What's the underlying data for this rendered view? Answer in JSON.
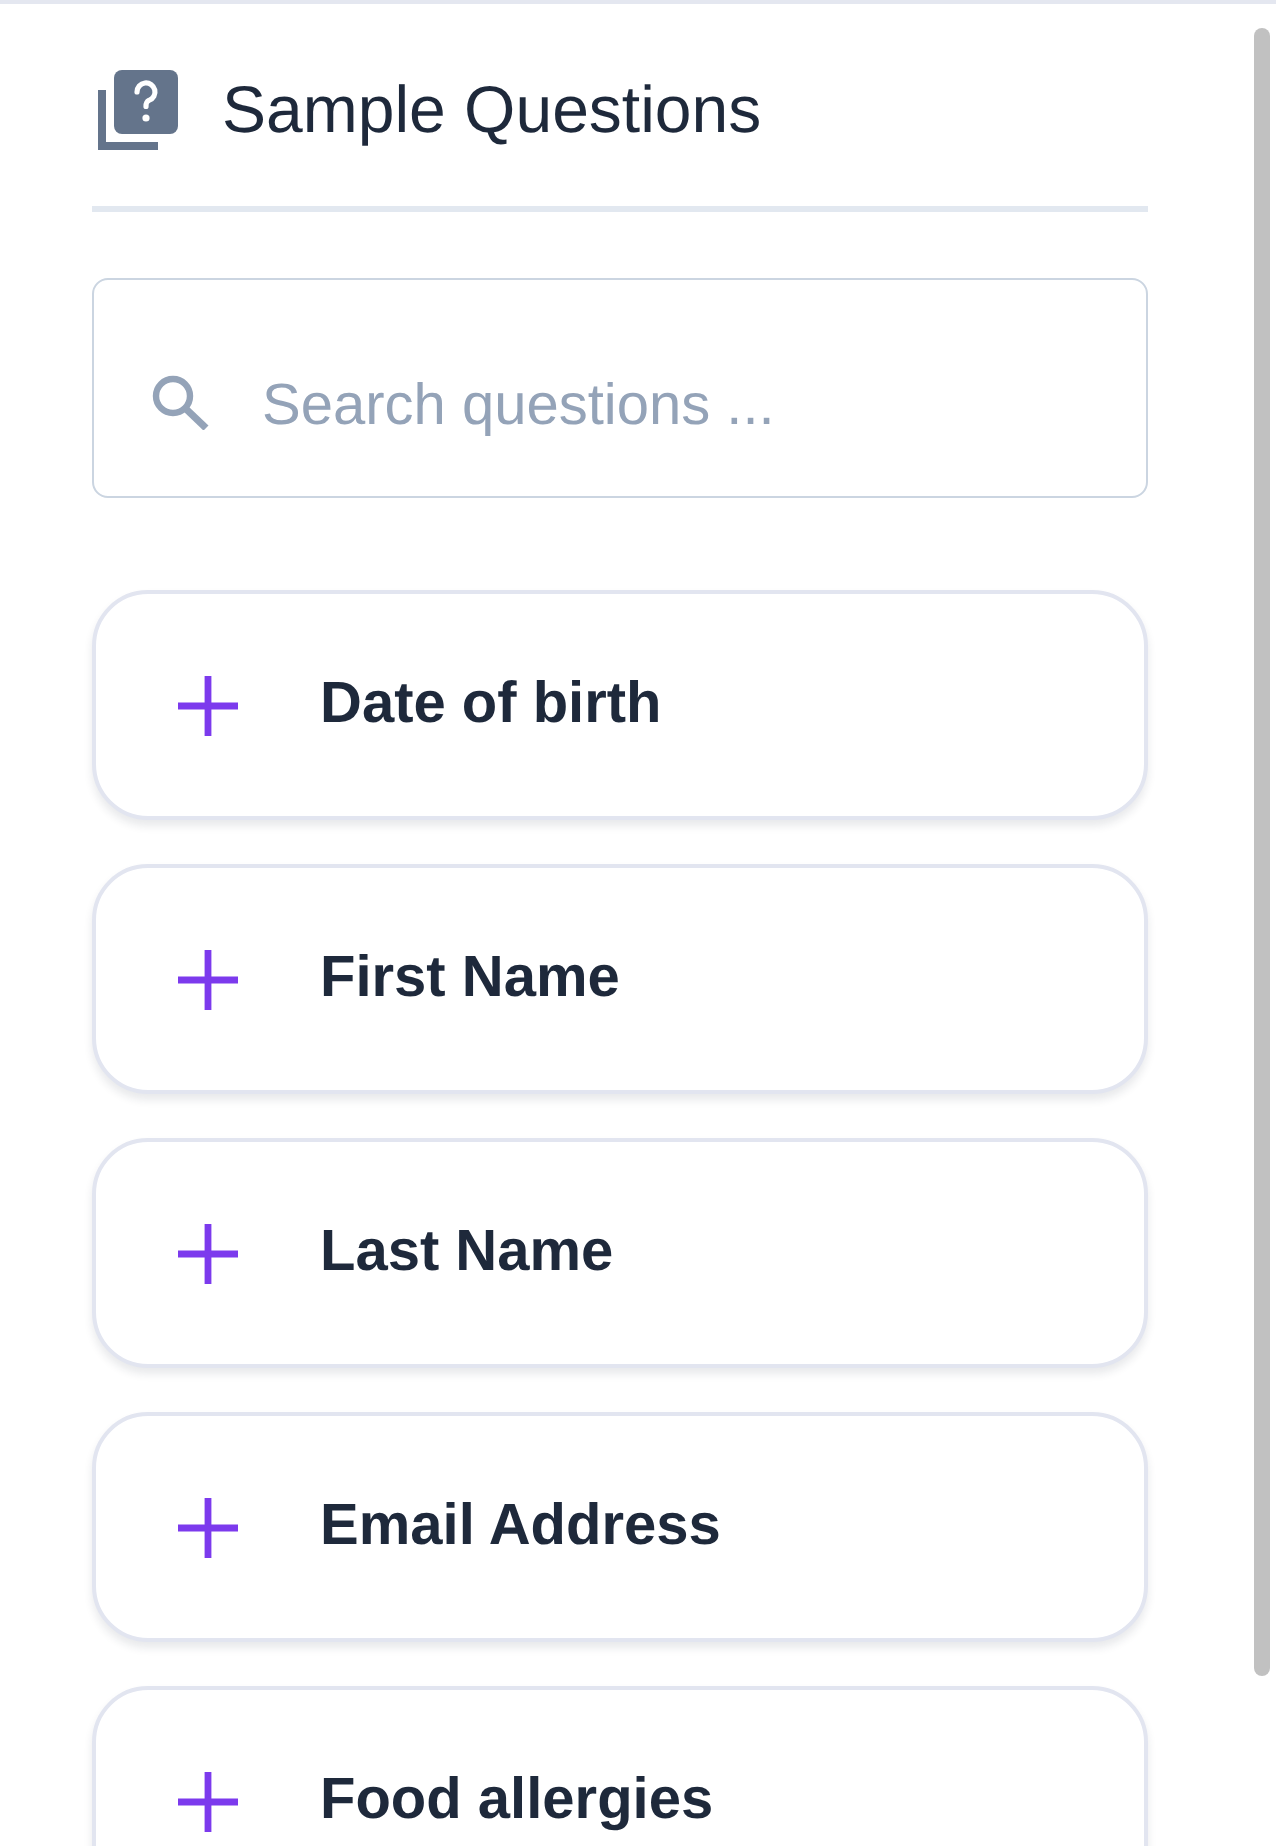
{
  "panel": {
    "title": "Sample Questions",
    "search": {
      "placeholder": "Search questions ..."
    },
    "questions": [
      {
        "label": "Date of birth"
      },
      {
        "label": "First Name"
      },
      {
        "label": "Last Name"
      },
      {
        "label": "Email Address"
      },
      {
        "label": "Food allergies"
      }
    ]
  }
}
